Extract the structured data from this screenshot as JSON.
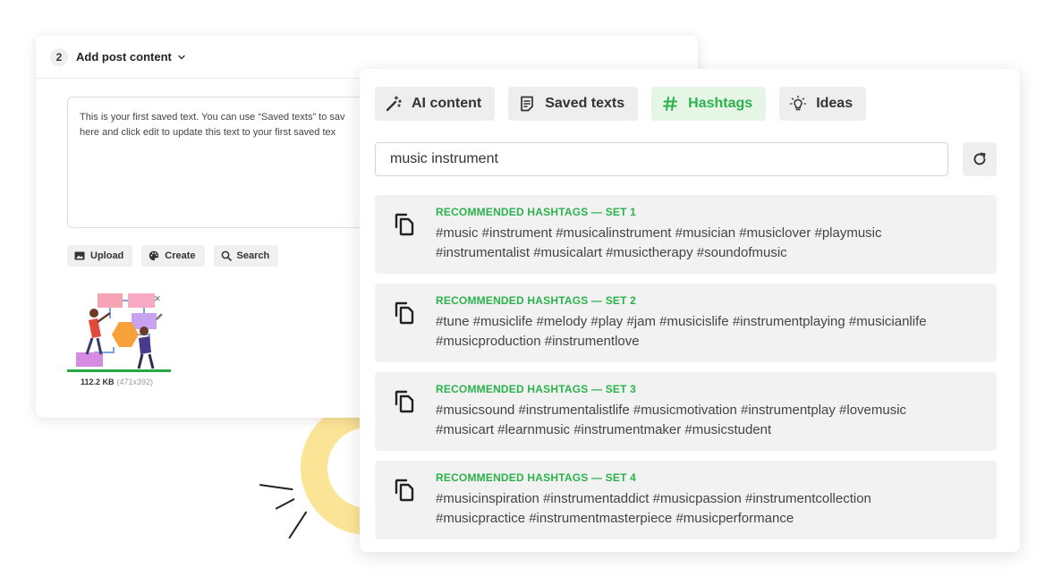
{
  "colors": {
    "accent_green": "#2bb24c",
    "active_tab_bg": "#e6f6e6",
    "ring_yellow": "#fce497"
  },
  "back_card": {
    "step": "2",
    "title": "Add post content",
    "editor_lines": [
      "This is your first saved text. You can use “Saved texts” to sav",
      "here and click edit to update this text to your first saved tex"
    ],
    "toolbar": [
      {
        "label": "Upload",
        "icon": "image-icon"
      },
      {
        "label": "Create",
        "icon": "palette-icon"
      },
      {
        "label": "Search",
        "icon": "search-icon"
      }
    ],
    "attachment": {
      "close": "×",
      "size": "112.2 KB",
      "dims": "(471x392)",
      "upload_progress": 1.0
    }
  },
  "front_card": {
    "tabs": [
      {
        "label": "AI content",
        "icon": "magic-wand-icon",
        "active": false
      },
      {
        "label": "Saved texts",
        "icon": "document-icon",
        "active": false
      },
      {
        "label": "Hashtags",
        "icon": "hash-icon",
        "active": true
      },
      {
        "label": "Ideas",
        "icon": "lightbulb-icon",
        "active": false
      }
    ],
    "search": {
      "value": "music instrument"
    },
    "sets": [
      {
        "title": "RECOMMENDED HASHTAGS — SET 1",
        "lines": [
          "#music #instrument #musicalinstrument #musician #musiclover #playmusic",
          "#instrumentalist #musicalart #musictherapy #soundofmusic"
        ]
      },
      {
        "title": "RECOMMENDED HASHTAGS — SET 2",
        "lines": [
          "#tune #musiclife #melody #play #jam #musicislife #instrumentplaying #musicianlife",
          "#musicproduction #instrumentlove"
        ]
      },
      {
        "title": "RECOMMENDED HASHTAGS — SET 3",
        "lines": [
          "#musicsound #instrumentalistlife #musicmotivation #instrumentplay #lovemusic",
          "#musicart #learnmusic #instrumentmaker #musicstudent"
        ]
      },
      {
        "title": "RECOMMENDED HASHTAGS — SET 4",
        "lines": [
          "#musicinspiration #instrumentaddict #musicpassion #instrumentcollection",
          "#musicpractice #instrumentmasterpiece #musicperformance"
        ]
      }
    ]
  }
}
